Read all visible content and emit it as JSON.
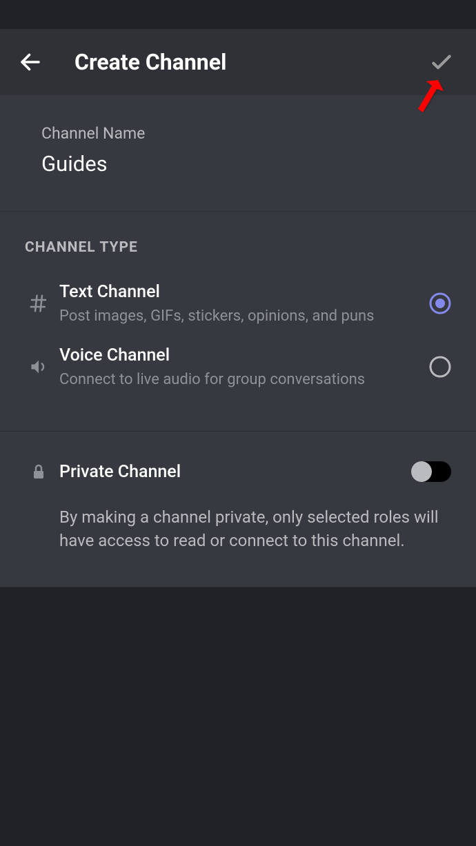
{
  "header": {
    "title": "Create Channel"
  },
  "name_section": {
    "label": "Channel Name",
    "value": "Guides"
  },
  "type_section": {
    "heading": "CHANNEL TYPE",
    "options": [
      {
        "title": "Text Channel",
        "desc": "Post images, GIFs, stickers, opinions, and puns",
        "selected": true
      },
      {
        "title": "Voice Channel",
        "desc": "Connect to live audio for group conversations",
        "selected": false
      }
    ]
  },
  "private_section": {
    "title": "Private Channel",
    "desc": "By making a channel private, only selected roles will have access to read or connect to this channel.",
    "enabled": false
  }
}
